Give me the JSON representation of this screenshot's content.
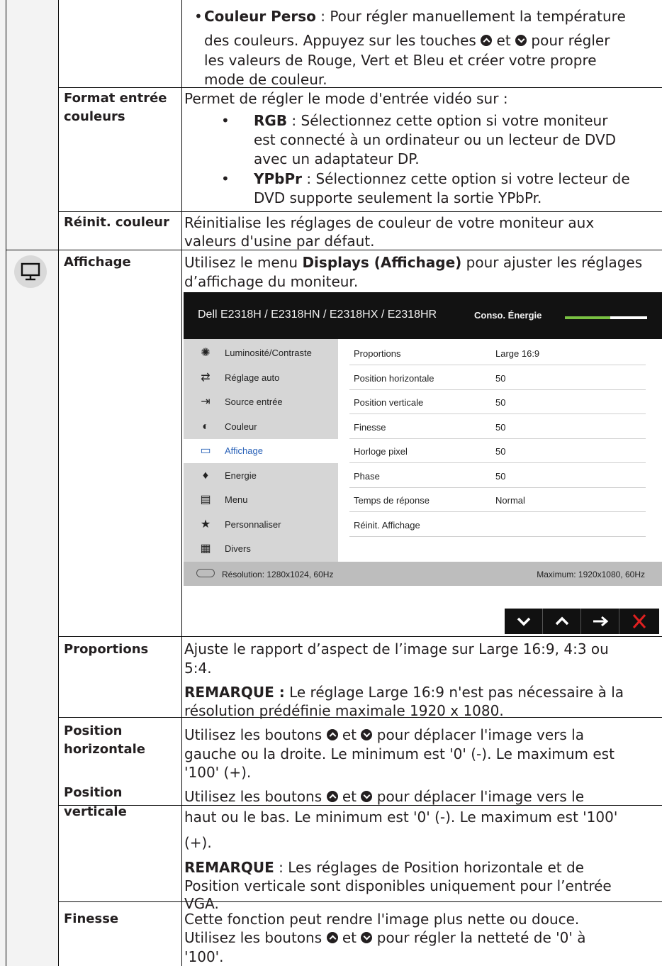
{
  "rows": {
    "couleur_perso": {
      "title": "Couleur Perso",
      "t1": " : Pour régler manuellement la température",
      "t2a": "des couleurs. Appuyez sur les touches ",
      "t2b": " et ",
      "t2c": " pour régler",
      "t3": "les valeurs de Rouge, Vert et Bleu et créer votre propre",
      "t4": "mode de couleur."
    },
    "format_entree": {
      "label_1": "Format entrée",
      "label_2": "couleurs",
      "intro": "Permet de régler le mode d'entrée vidéo sur :",
      "rgb_title": "RGB",
      "rgb_1": " : Sélectionnez cette option si votre moniteur",
      "rgb_2": "est connecté à un ordinateur ou un lecteur de DVD",
      "rgb_3": "avec un adaptateur DP.",
      "ypbpr_title": "YPbPr",
      "ypbpr_1": " : Sélectionnez cette option si votre lecteur de",
      "ypbpr_2": "DVD supporte seulement la sortie YPbPr."
    },
    "reinit_couleur": {
      "label": "Réinit. couleur",
      "t1": "Réinitialise les réglages de couleur de votre moniteur aux",
      "t2": "valeurs d'usine par défaut."
    },
    "affichage": {
      "label": "Affichage",
      "t1a": "Utilisez le menu ",
      "t1b": "Displays (Affichage)",
      "t1c": " pour ajuster les réglages",
      "t2": "d’affichage du moniteur."
    },
    "proportions": {
      "label": "Proportions",
      "t1": "Ajuste le rapport d’aspect de l’image sur Large 16:9, 4:3 ou",
      "t2": "5:4.",
      "note_title": "REMARQUE :",
      "note_1": " Le réglage Large 16:9 n'est pas nécessaire à la",
      "note_2": "résolution prédéfinie maximale 1920 x 1080."
    },
    "position_h": {
      "label_1": "Position",
      "label_2": "horizontale",
      "t1a": "Utilisez les boutons ",
      "t1b": " et ",
      "t1c": " pour déplacer l'image vers la",
      "t2": "gauche ou la droite. Le minimum est '0' (-). Le maximum est",
      "t3": "'100' (+)."
    },
    "position_v": {
      "label_1": "Position",
      "label_2": "verticale",
      "t1a": " Utilisez les boutons ",
      "t1b": " et ",
      "t1c": " pour déplacer l'image vers le",
      "t2": "haut ou le bas. Le minimum est '0' (-). Le maximum est '100'",
      "t3": "(+).",
      "note_title": "REMARQUE",
      "note_1": " : Les réglages de Position horizontale et de",
      "note_2": "Position verticale sont disponibles uniquement pour l’entrée",
      "note_3": "VGA."
    },
    "finesse": {
      "label": "Finesse",
      "t1": "Cette fonction peut rendre l'image plus nette ou douce.",
      "t2a": "Utilisez les boutons ",
      "t2b": " et ",
      "t2c": " pour régler la netteté de '0' à",
      "t3": "'100'."
    }
  },
  "osd": {
    "model": "Dell E2318H / E2318HN / E2318HX / E2318HR",
    "energy_label": "Conso. Énergie",
    "energy_level": 0.55,
    "menu": [
      {
        "label": "Luminosité/Contraste",
        "icon": "brightness-icon"
      },
      {
        "label": "Réglage auto",
        "icon": "auto-adjust-icon"
      },
      {
        "label": "Source entrée",
        "icon": "input-source-icon"
      },
      {
        "label": "Couleur",
        "icon": "color-icon"
      },
      {
        "label": "Affichage",
        "icon": "display-icon",
        "active": true
      },
      {
        "label": "Energie",
        "icon": "energy-icon"
      },
      {
        "label": "Menu",
        "icon": "menu-icon"
      },
      {
        "label": "Personnaliser",
        "icon": "star-icon"
      },
      {
        "label": "Divers",
        "icon": "others-icon"
      }
    ],
    "settings": [
      {
        "key": "Proportions",
        "value": "Large 16:9"
      },
      {
        "key": "Position horizontale",
        "value": "50"
      },
      {
        "key": "Position verticale",
        "value": "50"
      },
      {
        "key": "Finesse",
        "value": "50"
      },
      {
        "key": "Horloge pixel",
        "value": "50"
      },
      {
        "key": "Phase",
        "value": "50"
      },
      {
        "key": "Temps de réponse",
        "value": "Normal"
      },
      {
        "key": "Réinit. Affichage",
        "value": ""
      }
    ],
    "resolution": "Résolution: 1280x1024, 60Hz",
    "maximum": "Maximum: 1920x1080, 60Hz",
    "accent": "#79c142",
    "active_color": "#2a62b8"
  }
}
